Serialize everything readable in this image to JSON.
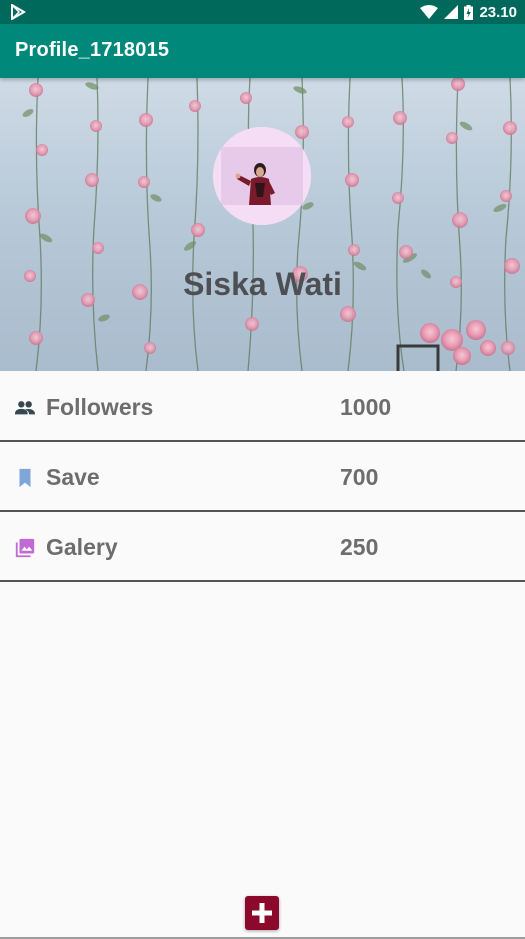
{
  "status_bar": {
    "time": "23.10",
    "icons": [
      "play-store-notification-icon",
      "wifi-icon",
      "signal-icon",
      "battery-charging-icon"
    ]
  },
  "app_bar": {
    "title": "Profile_1718015"
  },
  "profile": {
    "name": "Siska Wati",
    "avatar": "profile-photo"
  },
  "stats": [
    {
      "label": "Followers",
      "value": "1000",
      "icon": "people-icon",
      "icon_color": "#37474f"
    },
    {
      "label": "Save",
      "value": "700",
      "icon": "bookmark-icon",
      "icon_color": "#7fa6d9"
    },
    {
      "label": "Galery",
      "value": "250",
      "icon": "photo-library-icon",
      "icon_color": "#c06bd3"
    }
  ],
  "fab": {
    "icon": "add-icon",
    "color": "#8b0a2b"
  },
  "colors": {
    "primary": "#00897b",
    "primary_dark": "#00695c",
    "text": "#6d6d6d"
  }
}
